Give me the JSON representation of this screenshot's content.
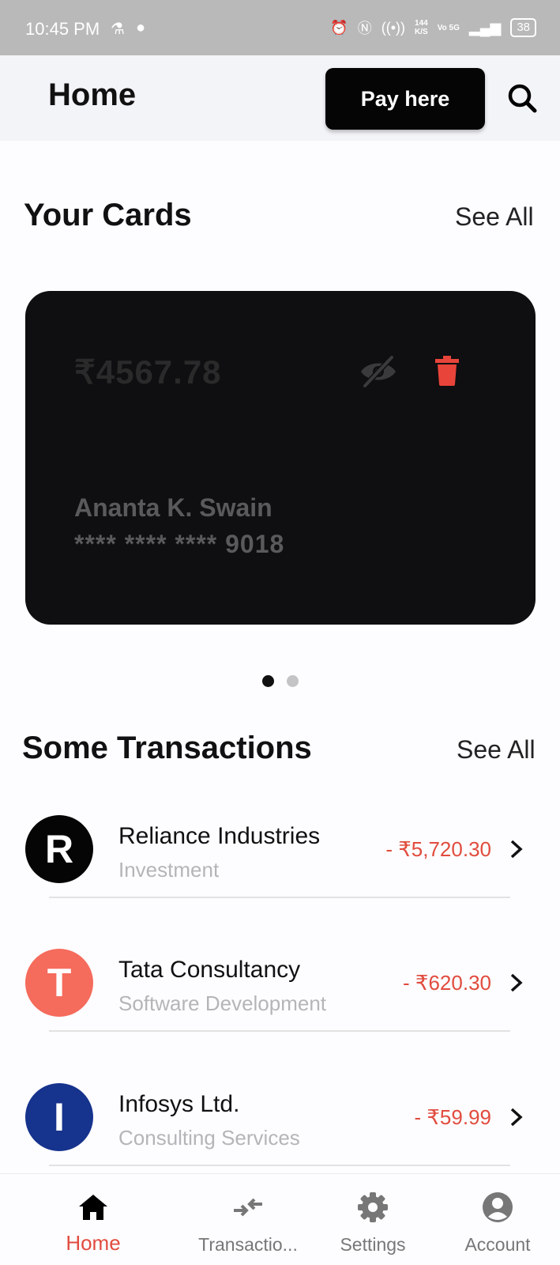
{
  "status_bar": {
    "time": "10:45 PM",
    "speed_value": "144",
    "speed_unit": "K/S",
    "network": "Vo 5G",
    "battery": "38"
  },
  "app_bar": {
    "title": "Home",
    "pay_button_label": "Pay here"
  },
  "cards_section": {
    "title": "Your Cards",
    "see_all": "See All"
  },
  "card": {
    "balance": "₹4567.78",
    "holder": "Ananta K. Swain",
    "number": "**** **** **** 9018"
  },
  "transactions_section": {
    "title": "Some Transactions",
    "see_all": "See All"
  },
  "transactions": [
    {
      "initial": "R",
      "name": "Reliance Industries",
      "category": "Investment",
      "amount": "- ₹5,720.30",
      "avatar_color": "#050505"
    },
    {
      "initial": "T",
      "name": "Tata Consultancy",
      "category": "Software Development",
      "amount": "- ₹620.30",
      "avatar_color": "#f56b5c"
    },
    {
      "initial": "I",
      "name": "Infosys Ltd.",
      "category": "Consulting Services",
      "amount": "- ₹59.99",
      "avatar_color": "#16338d"
    }
  ],
  "bottom_nav": [
    {
      "label": "Home",
      "icon": "home-icon",
      "active": true
    },
    {
      "label": "Transactio...",
      "icon": "transactions-icon",
      "active": false
    },
    {
      "label": "Settings",
      "icon": "settings-icon",
      "active": false
    },
    {
      "label": "Account",
      "icon": "account-icon",
      "active": false
    }
  ],
  "colors": {
    "accent": "#e14c3e",
    "card_bg": "#0f0e10",
    "delete": "#e8443a"
  }
}
